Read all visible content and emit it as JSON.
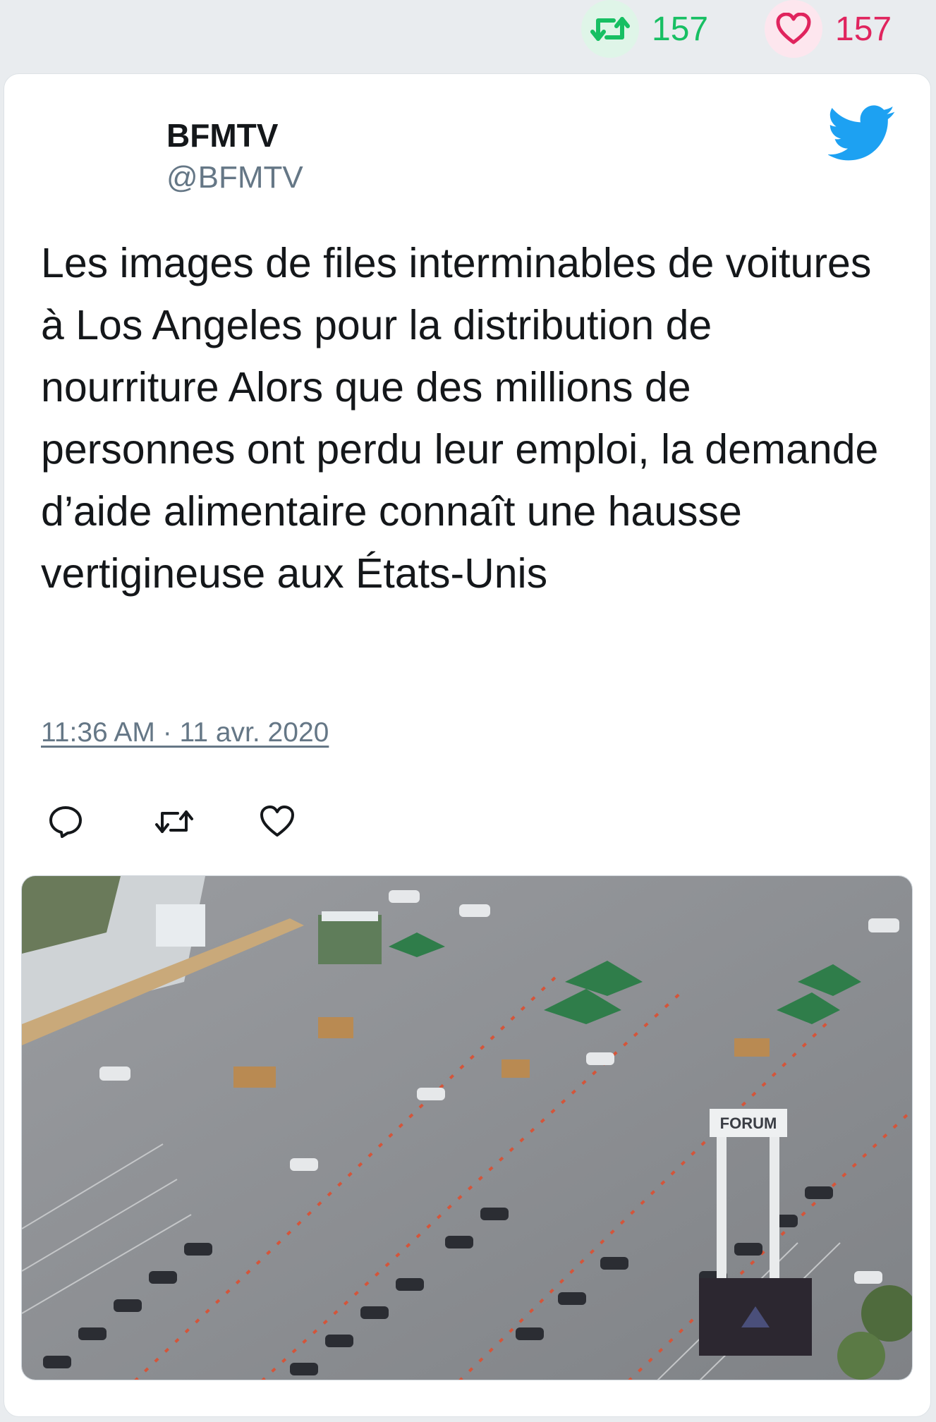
{
  "stats": {
    "retweets": "157",
    "likes": "157",
    "retweet_icon": "retweet-icon",
    "like_icon": "heart-icon",
    "retweet_color": "#17bf63",
    "like_color": "#e0245e"
  },
  "tweet": {
    "author_name": "BFMTV",
    "author_handle": "@BFMTV",
    "brand_icon": "twitter-bird-icon",
    "brand_color": "#1da1f2",
    "text": "Les images de files interminables de voitures à Los Angeles pour la distribution de nourriture Alors que des millions de personnes ont perdu leur emploi, la demande d’aide alimentaire connaît une hausse vertigineuse aux États-Unis",
    "timestamp": "11:36 AM · 11 avr. 2020",
    "actions": [
      "reply-icon",
      "retweet-icon",
      "like-icon"
    ],
    "media_sign_text": "FORUM"
  }
}
